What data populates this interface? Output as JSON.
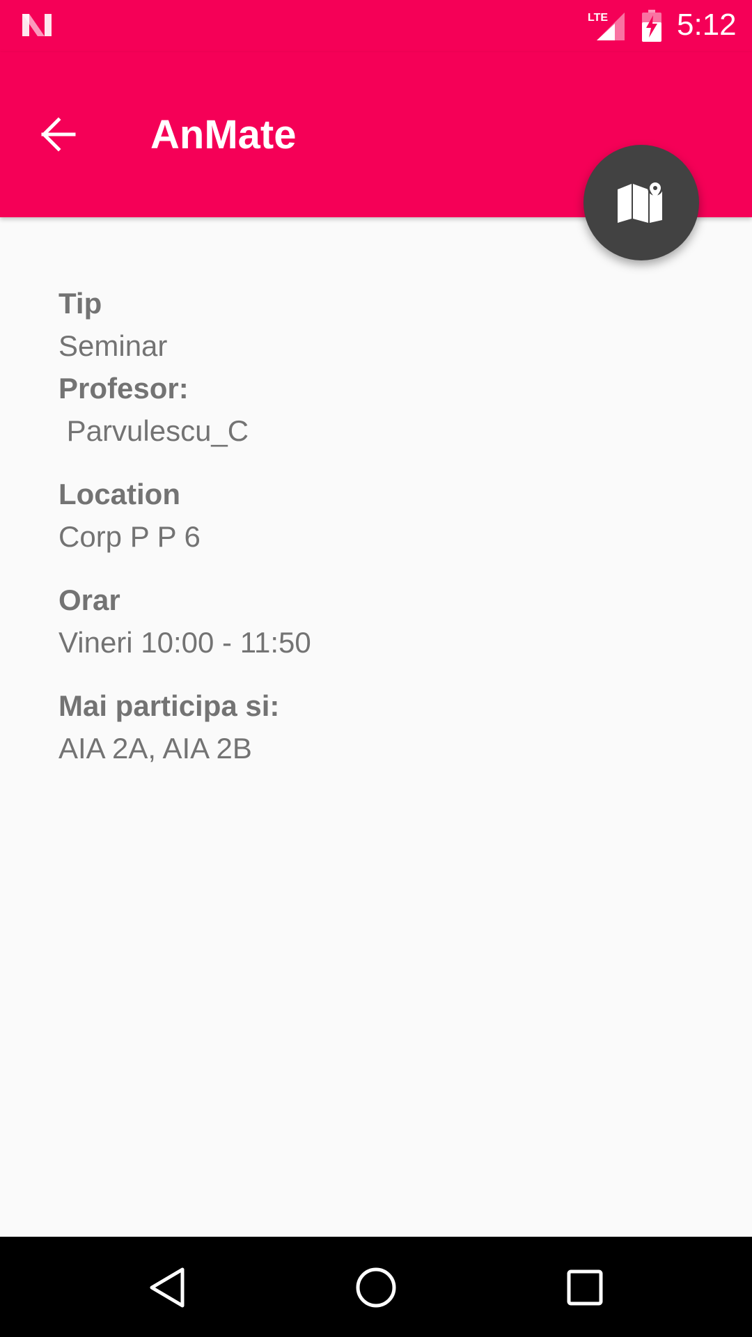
{
  "status_bar": {
    "time": "5:12",
    "network_label": "LTE",
    "icons": [
      "n-logo-icon",
      "lte-signal-icon",
      "battery-charging-icon"
    ]
  },
  "app_bar": {
    "title": "AnMate",
    "back_icon": "arrow-back-icon",
    "color": "#f50057"
  },
  "fab": {
    "icon": "map-pin-icon",
    "color": "#424242"
  },
  "details": {
    "type_label": "Tip",
    "type_value": "Seminar",
    "professor_label": "Profesor:",
    "professor_value": " Parvulescu_C",
    "location_label": "Location",
    "location_value": "Corp P P 6",
    "schedule_label": "Orar",
    "schedule_value": "Vineri 10:00 - 11:50",
    "participants_label": "Mai participa si:",
    "participants_value": "AIA 2A, AIA 2B"
  },
  "nav_bar": {
    "icons": [
      "back-triangle-icon",
      "home-circle-icon",
      "recents-square-icon"
    ]
  }
}
